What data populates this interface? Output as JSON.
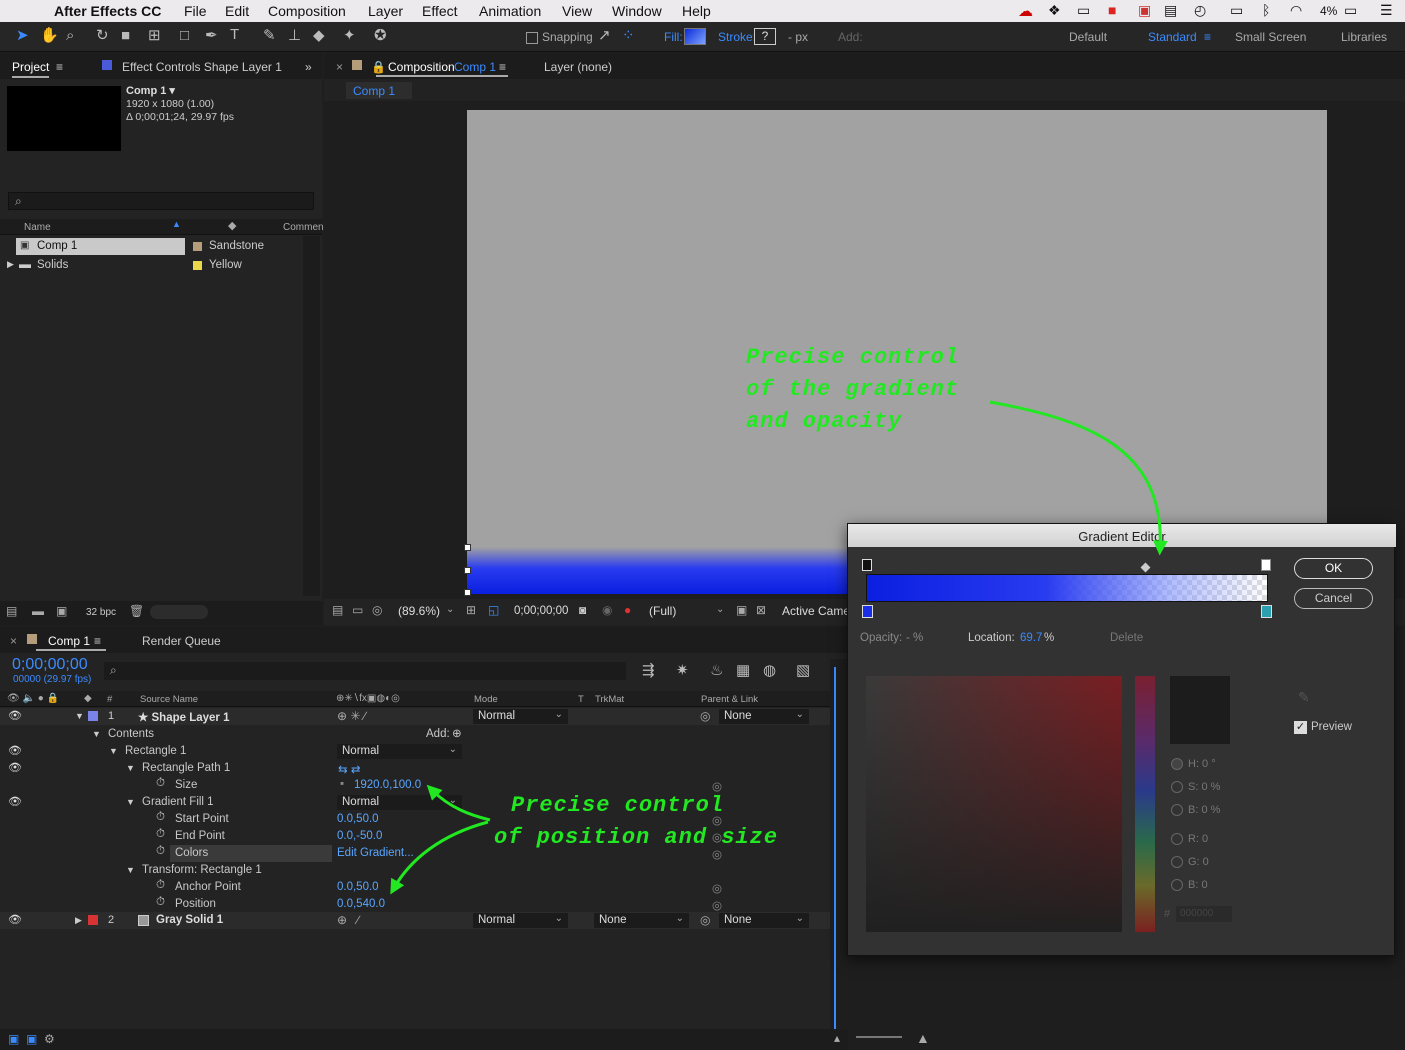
{
  "menubar": {
    "app": "After Effects CC",
    "items": [
      "File",
      "Edit",
      "Composition",
      "Layer",
      "Effect",
      "Animation",
      "View",
      "Window",
      "Help"
    ],
    "battery": "4%"
  },
  "toolbar": {
    "snapping": "Snapping",
    "fill": "Fill:",
    "stroke": "Stroke:",
    "stroke_val": "?",
    "px": "- px",
    "add": "Add:",
    "workspaces": [
      "Default",
      "Standard",
      "Small Screen",
      "Libraries"
    ]
  },
  "project": {
    "tab": "Project",
    "effect_tab": "Effect Controls Shape Layer 1",
    "comp_name": "Comp 1 ▾",
    "comp_size": "1920 x 1080 (1.00)",
    "comp_dur": "Δ 0;00;01;24, 29.97 fps",
    "col_name": "Name",
    "col_comment": "Commen",
    "items": [
      {
        "name": "Comp 1",
        "label": "Sandstone",
        "color": "#b59c7a"
      },
      {
        "name": "Solids",
        "label": "Yellow",
        "color": "#e8d84a"
      }
    ],
    "bpc": "32 bpc"
  },
  "viewer": {
    "tab": "Composition",
    "comp_link": "Comp 1",
    "layer_tab": "Layer (none)",
    "subtab": "Comp 1",
    "zoom": "(89.6%)",
    "time": "0;00;00;00",
    "quality": "(Full)",
    "camera": "Active Camer"
  },
  "notes": {
    "top": [
      "Precise control",
      "of the gradient",
      "and opacity"
    ],
    "bottom": [
      "Precise control",
      "of position and size"
    ]
  },
  "gradient": {
    "title": "Gradient Editor",
    "ok": "OK",
    "cancel": "Cancel",
    "opacity_label": "Opacity:",
    "opacity_val": "- %",
    "location_label": "Location:",
    "location_val": "69.7",
    "location_unit": "%",
    "delete": "Delete",
    "preview": "Preview",
    "hsb": [
      "H: 0 °",
      "S: 0 %",
      "B: 0 %"
    ],
    "rgb": [
      "R: 0",
      "G: 0",
      "B: 0"
    ],
    "hex": "#",
    "hex_val": "000000",
    "colors": {
      "start": "#0a1fe0",
      "mid": "#2a3cf0",
      "end": "#ffffff"
    }
  },
  "timeline": {
    "tab": "Comp 1",
    "render_tab": "Render Queue",
    "timecode": "0;00;00;00",
    "frames": "00000 (29.97 fps)",
    "cols": {
      "num": "#",
      "source": "Source Name",
      "mode": "Mode",
      "t": "T",
      "trkmat": "TrkMat",
      "parent": "Parent & Link"
    },
    "rows": [
      {
        "num": "1",
        "name": "★ Shape Layer 1",
        "mode": "Normal",
        "parent": "None"
      },
      {
        "name": "Contents",
        "add": "Add:"
      },
      {
        "name": "Rectangle 1",
        "mode": "Normal"
      },
      {
        "name": "Rectangle Path 1"
      },
      {
        "name": "Size",
        "value": "1920.0,100.0"
      },
      {
        "name": "Gradient Fill 1",
        "mode": "Normal"
      },
      {
        "name": "Start Point",
        "value": "0.0,50.0"
      },
      {
        "name": "End Point",
        "value": "0.0,-50.0"
      },
      {
        "name": "Colors",
        "value": "Edit Gradient..."
      },
      {
        "name": "Transform: Rectangle 1"
      },
      {
        "name": "Anchor Point",
        "value": "0.0,50.0"
      },
      {
        "name": "Position",
        "value": "0.0,540.0"
      },
      {
        "num": "2",
        "name": "Gray Solid 1",
        "mode": "Normal",
        "trkmat": "None",
        "parent": "None"
      }
    ]
  }
}
